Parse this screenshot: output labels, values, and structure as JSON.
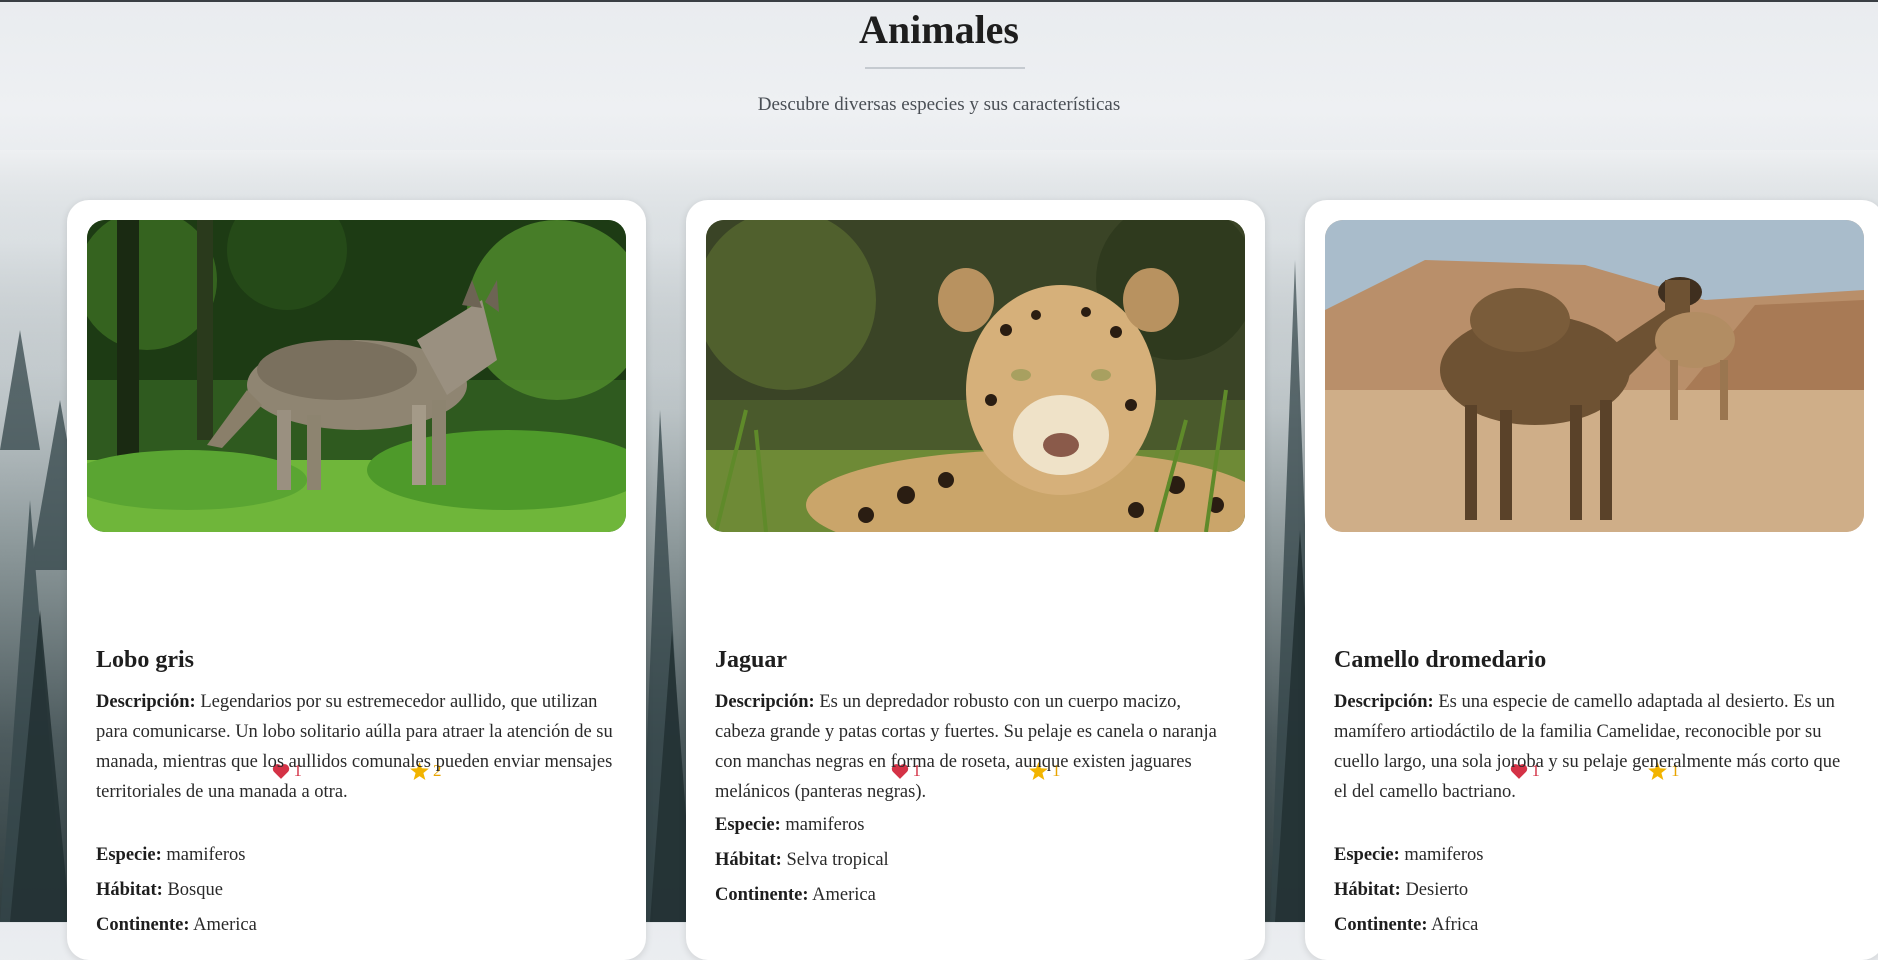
{
  "header": {
    "title": "Animales",
    "subtitle": "Descubre diversas especies y sus características"
  },
  "labels": {
    "description": "Descripción:",
    "species": "Especie:",
    "habitat": "Hábitat:",
    "continent": "Continente:"
  },
  "animals": [
    {
      "name": "Lobo gris",
      "likes": "1",
      "favorites": "2",
      "description": "Legendarios por su estremecedor aullido, que utilizan para comunicarse. Un lobo solitario aúlla para atraer la atención de su manada, mientras que los aullidos comunales pueden enviar mensajes territoriales de una manada a otra.",
      "species": "mamiferos",
      "habitat": "Bosque",
      "continent": "America"
    },
    {
      "name": "Jaguar",
      "likes": "1",
      "favorites": "1",
      "description": "Es un depredador robusto con un cuerpo macizo, cabeza grande y patas cortas y fuertes. Su pelaje es canela o naranja con manchas negras en forma de roseta, aunque existen jaguares melánicos (panteras negras).",
      "species": "mamiferos",
      "habitat": "Selva tropical",
      "continent": "America"
    },
    {
      "name": "Camello dromedario",
      "likes": "1",
      "favorites": "1",
      "description": "Es una especie de camello adaptada al desierto. Es un mamífero artiodáctilo de la familia Camelidae, reconocible por su cuello largo, una sola joroba y su pelaje generalmente más corto que el del camello bactriano.",
      "species": "mamiferos",
      "habitat": "Desierto",
      "continent": "Africa"
    }
  ],
  "icons": {
    "likes": "heart-icon",
    "favorites": "star-icon"
  },
  "colors": {
    "like": "#d43246",
    "favorite": "#e8a400",
    "card": "#ffffff"
  }
}
